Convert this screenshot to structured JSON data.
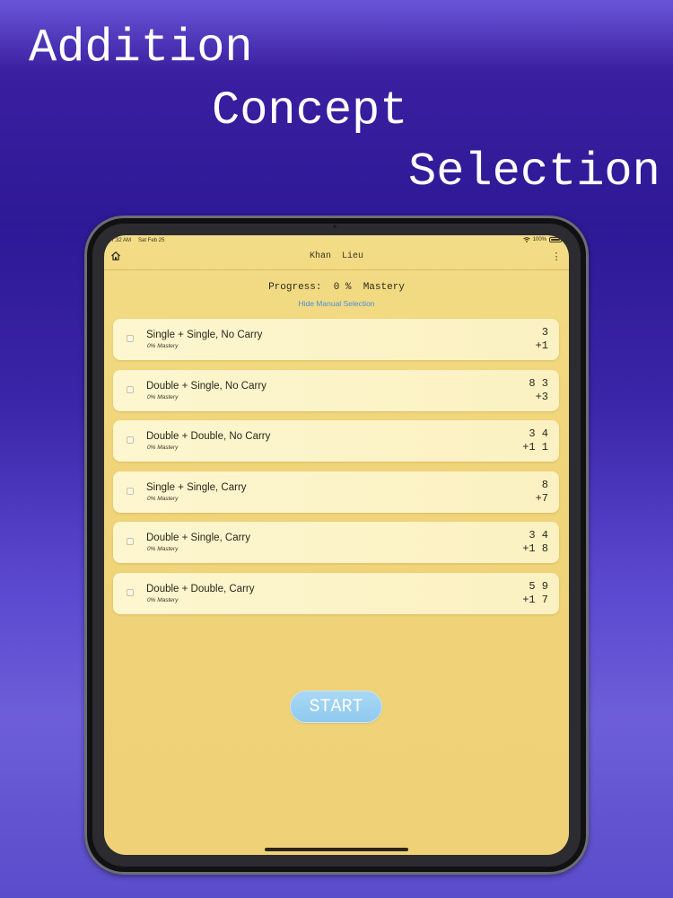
{
  "headline": {
    "line1": "Addition",
    "line2": "Concept",
    "line3": "Selection"
  },
  "status_bar": {
    "time": "7:32 AM",
    "date": "Sat Feb 25",
    "battery": "100%"
  },
  "nav": {
    "title": "Khan  Lieu",
    "more_icon": "⋮"
  },
  "progress": {
    "label": "Progress:",
    "value": "0 %",
    "suffix": "Mastery"
  },
  "toggle_link": "Hide Manual Selection",
  "concepts": [
    {
      "title": "Single + Single, No Carry",
      "mastery": "0% Mastery",
      "top": "3",
      "bottom": "+1"
    },
    {
      "title": "Double + Single, No Carry",
      "mastery": "0% Mastery",
      "top": "8 3",
      "bottom": "+3"
    },
    {
      "title": "Double + Double, No Carry",
      "mastery": "0% Mastery",
      "top": "3 4",
      "bottom": "+1 1"
    },
    {
      "title": "Single + Single, Carry",
      "mastery": "0% Mastery",
      "top": "8",
      "bottom": "+7"
    },
    {
      "title": "Double + Single, Carry",
      "mastery": "0% Mastery",
      "top": "3 4",
      "bottom": "+1 8"
    },
    {
      "title": "Double + Double, Carry",
      "mastery": "0% Mastery",
      "top": "5 9",
      "bottom": "+1 7"
    }
  ],
  "start_label": "START",
  "icons": {
    "home": "home-icon",
    "wifi": "wifi-icon",
    "battery": "battery-icon",
    "more": "more-vertical-icon"
  }
}
